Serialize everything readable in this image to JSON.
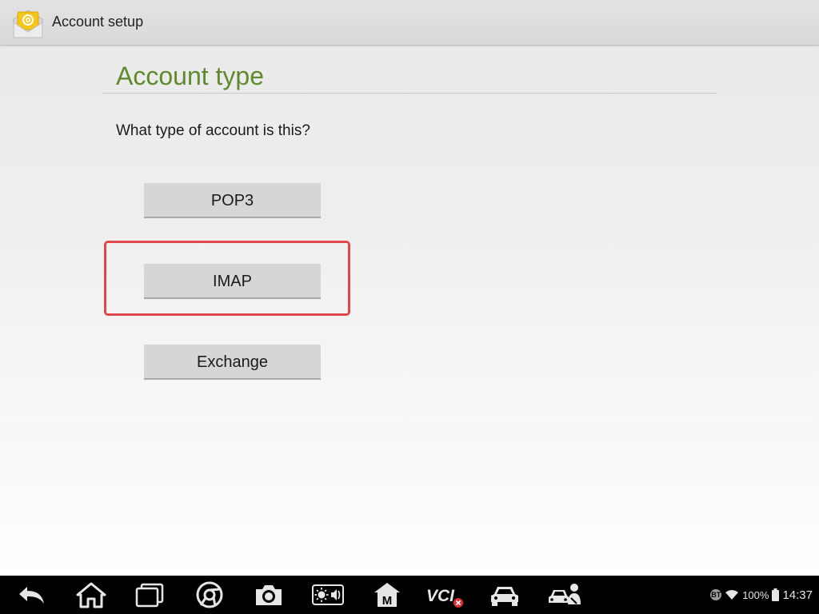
{
  "action_bar": {
    "icon": "email-app-icon",
    "title": "Account setup"
  },
  "page": {
    "title": "Account type",
    "question": "What type of account is this?"
  },
  "options": [
    {
      "label": "POP3"
    },
    {
      "label": "IMAP"
    },
    {
      "label": "Exchange"
    }
  ],
  "highlighted_option": "IMAP",
  "colors": {
    "title_green": "#5f8a2e",
    "highlight_red": "#e0474c",
    "button_gray": "#d6d6d6"
  },
  "nav_bar": {
    "icons": [
      "back-icon",
      "home-icon",
      "recent-apps-icon",
      "chrome-browser-icon",
      "camera-icon",
      "brightness-volume-icon",
      "maxifix-m-icon",
      "vci-icon",
      "car-icon",
      "car-technician-icon"
    ]
  },
  "status": {
    "bluetooth": "BT",
    "battery": "100%",
    "time": "14:37"
  }
}
